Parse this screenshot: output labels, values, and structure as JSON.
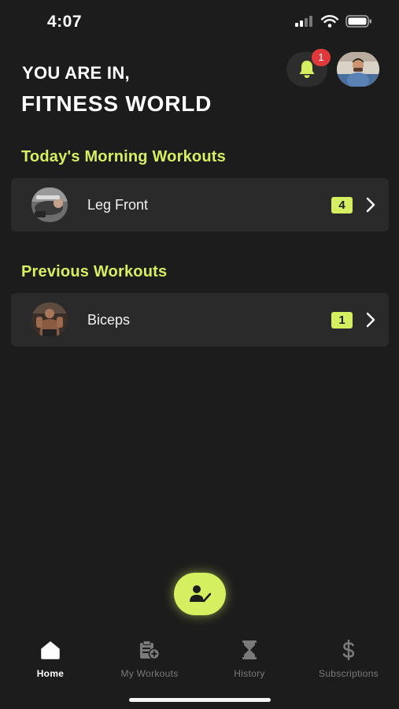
{
  "status_bar": {
    "time": "4:07"
  },
  "header": {
    "greeting_line1": "YOU ARE IN,",
    "greeting_line2": "FITNESS WORLD",
    "notification_count": "1"
  },
  "sections": {
    "today_title": "Today's Morning Workouts",
    "previous_title": "Previous Workouts"
  },
  "today_workouts": [
    {
      "name": "Leg Front",
      "count": "4"
    }
  ],
  "previous_workouts": [
    {
      "name": "Biceps",
      "count": "1"
    }
  ],
  "tabs": [
    {
      "label": "Home",
      "icon": "home-icon",
      "active": true
    },
    {
      "label": "My Workouts",
      "icon": "clipboard-add-icon",
      "active": false
    },
    {
      "label": "History",
      "icon": "hourglass-icon",
      "active": false
    },
    {
      "label": "Subscriptions",
      "icon": "dollar-icon",
      "active": false
    }
  ],
  "colors": {
    "accent": "#d4ef5f",
    "background": "#1c1c1c",
    "card": "#2a2a2a",
    "badge": "#e0393b"
  }
}
